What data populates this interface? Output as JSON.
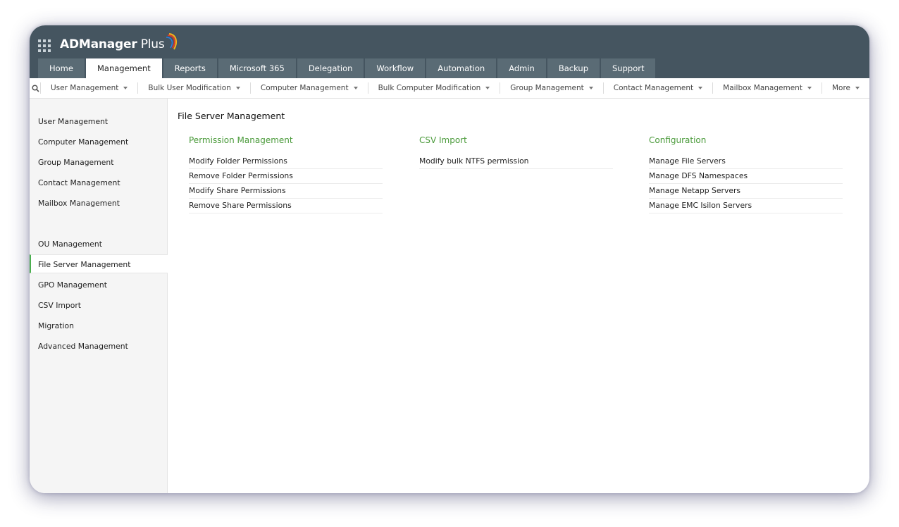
{
  "app": {
    "name": "ADManager",
    "name_suffix": " Plus",
    "colors": {
      "header": "#455560",
      "tab": "#5a6b75",
      "accent_green": "#4a9a3a"
    }
  },
  "main_tabs": [
    {
      "label": "Home",
      "active": false
    },
    {
      "label": "Management",
      "active": true
    },
    {
      "label": "Reports",
      "active": false
    },
    {
      "label": "Microsoft 365",
      "active": false
    },
    {
      "label": "Delegation",
      "active": false
    },
    {
      "label": "Workflow",
      "active": false
    },
    {
      "label": "Automation",
      "active": false
    },
    {
      "label": "Admin",
      "active": false
    },
    {
      "label": "Backup",
      "active": false
    },
    {
      "label": "Support",
      "active": false
    }
  ],
  "subnav": {
    "search_icon": "search-icon",
    "items": [
      {
        "label": "User Management"
      },
      {
        "label": "Bulk User Modification"
      },
      {
        "label": "Computer Management"
      },
      {
        "label": "Bulk Computer Modification"
      },
      {
        "label": "Group Management"
      },
      {
        "label": "Contact Management"
      },
      {
        "label": "Mailbox Management"
      },
      {
        "label": "More"
      }
    ]
  },
  "sidebar": {
    "items": [
      {
        "label": "User Management",
        "active": false
      },
      {
        "label": "Computer Management",
        "active": false
      },
      {
        "label": "Group Management",
        "active": false
      },
      {
        "label": "Contact Management",
        "active": false
      },
      {
        "label": "Mailbox Management",
        "active": false
      },
      {
        "label": "OU Management",
        "active": false
      },
      {
        "label": "File Server Management",
        "active": true
      },
      {
        "label": "GPO Management",
        "active": false
      },
      {
        "label": "CSV Import",
        "active": false
      },
      {
        "label": "Migration",
        "active": false
      },
      {
        "label": "Advanced Management",
        "active": false
      }
    ]
  },
  "main": {
    "title": "File Server Management",
    "sections": [
      {
        "title": "Permission Management",
        "links": [
          "Modify Folder Permissions",
          "Remove Folder Permissions",
          "Modify Share Permissions",
          "Remove Share Permissions"
        ]
      },
      {
        "title": "CSV Import",
        "links": [
          "Modify bulk NTFS permission"
        ]
      },
      {
        "title": "Configuration",
        "links": [
          "Manage File Servers",
          "Manage DFS Namespaces",
          "Manage Netapp Servers",
          "Manage EMC Isilon Servers"
        ]
      }
    ]
  }
}
